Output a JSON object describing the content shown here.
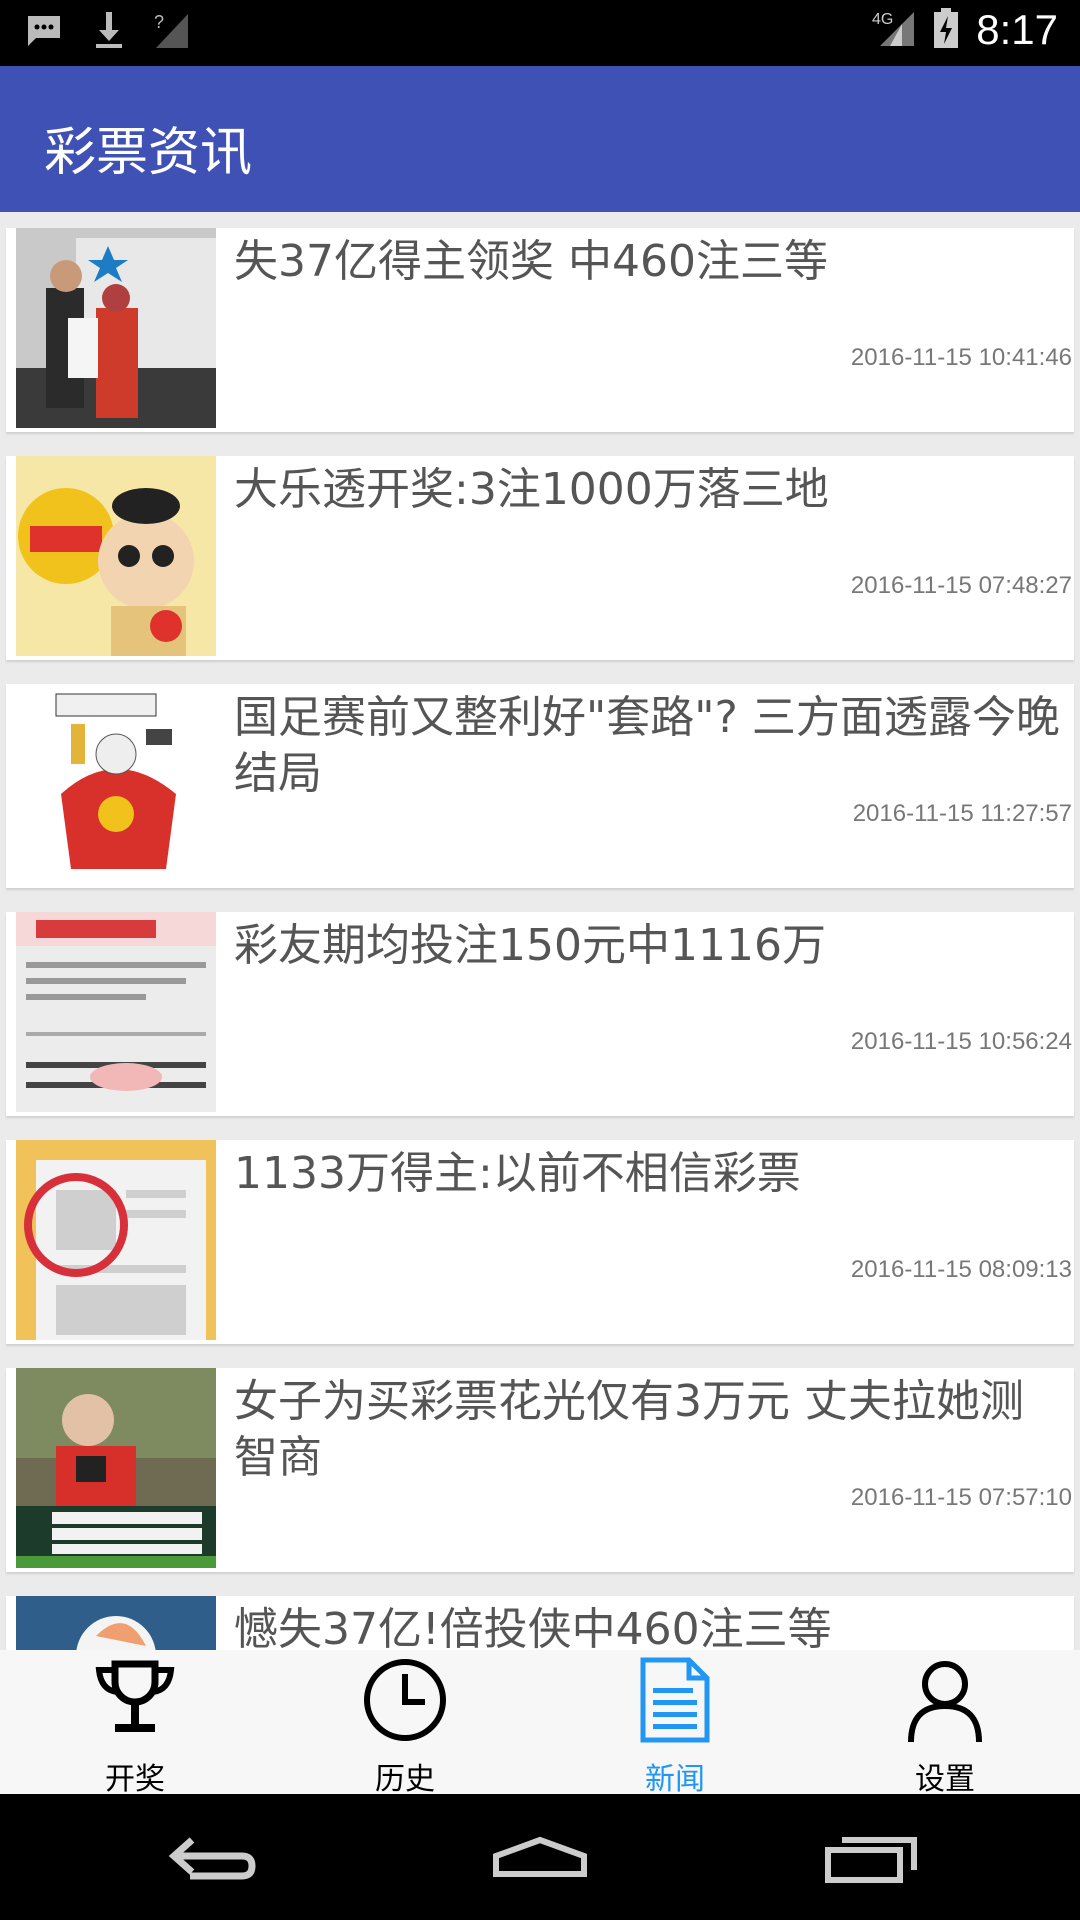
{
  "status_bar": {
    "time": "8:17",
    "network": "4G",
    "icons_left": [
      "message-icon",
      "download-icon",
      "no-signal-icon"
    ],
    "icons_right": [
      "signal-icon",
      "battery-charging-icon"
    ]
  },
  "app_bar": {
    "title": "彩票资讯",
    "color": "#3f51b5"
  },
  "news": [
    {
      "title": "失37亿得主领奖 中460注三等",
      "time": "2016-11-15 10:41:46"
    },
    {
      "title": "大乐透开奖:3注1000万落三地",
      "time": "2016-11-15 07:48:27"
    },
    {
      "title": "国足赛前又整利好\"套路\"? 三方面透露今晚结局",
      "time": "2016-11-15 11:27:57"
    },
    {
      "title": "彩友期均投注150元中1116万",
      "time": "2016-11-15 10:56:24"
    },
    {
      "title": "1133万得主:以前不相信彩票",
      "time": "2016-11-15 08:09:13"
    },
    {
      "title": "女子为买彩票花光仅有3万元 丈夫拉她测智商",
      "time": "2016-11-15 07:57:10"
    },
    {
      "title": "憾失37亿!倍投侠中460注三等",
      "time": ""
    }
  ],
  "bottom_nav": {
    "tabs": [
      {
        "label": "开奖",
        "icon": "trophy-icon"
      },
      {
        "label": "历史",
        "icon": "clock-icon"
      },
      {
        "label": "新闻",
        "icon": "news-document-icon"
      },
      {
        "label": "设置",
        "icon": "user-icon"
      }
    ],
    "active_index": 2,
    "active_color": "#2196f3"
  },
  "system_nav": [
    "back-icon",
    "home-icon",
    "recents-icon"
  ]
}
